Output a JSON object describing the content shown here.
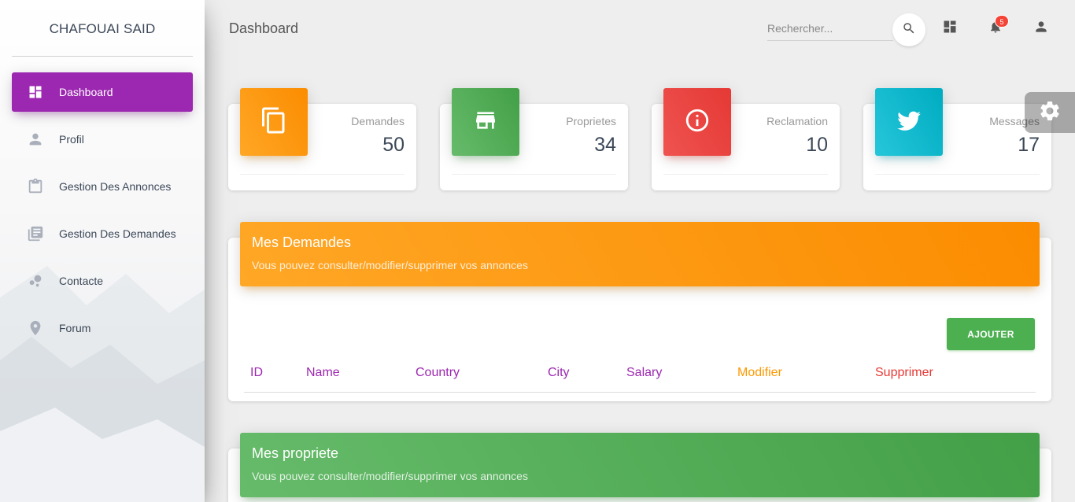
{
  "sidebar": {
    "brand": "CHAFOUAI SAID",
    "items": [
      {
        "label": "Dashboard",
        "icon": "dashboard-icon",
        "active": true
      },
      {
        "label": "Profil",
        "icon": "person-icon"
      },
      {
        "label": "Gestion Des Annonces",
        "icon": "clipboard-icon"
      },
      {
        "label": "Gestion Des Demandes",
        "icon": "library-books-icon"
      },
      {
        "label": "Contacte",
        "icon": "bubble-chart-icon"
      },
      {
        "label": "Forum",
        "icon": "location-pin-icon"
      }
    ],
    "accent_color": "#9c27b0"
  },
  "header": {
    "title": "Dashboard",
    "search_placeholder": "Rechercher...",
    "notification_count": "5"
  },
  "stats": [
    {
      "label": "Demandes",
      "value": "50",
      "icon": "copy-icon",
      "color": "#fb8c00"
    },
    {
      "label": "Proprietes",
      "value": "34",
      "icon": "store-icon",
      "color": "#43a047"
    },
    {
      "label": "Reclamation",
      "value": "10",
      "icon": "info-icon",
      "color": "#e53935"
    },
    {
      "label": "Messages",
      "value": "17",
      "icon": "twitter-icon",
      "color": "#00acc1"
    }
  ],
  "demandes_panel": {
    "title": "Mes Demandes",
    "subtitle": "Vous pouvez consulter/modifier/supprimer vos annonces",
    "add_label": "AJOUTER",
    "columns": [
      "ID",
      "Name",
      "Country",
      "City",
      "Salary",
      "Modifier",
      "Supprimer"
    ],
    "column_colors": [
      "#9c27b0",
      "#9c27b0",
      "#9c27b0",
      "#9c27b0",
      "#9c27b0",
      "#ff9800",
      "#e53935"
    ]
  },
  "propriete_panel": {
    "title": "Mes propriete",
    "subtitle": "Vous pouvez consulter/modifier/supprimer vos annonces"
  }
}
